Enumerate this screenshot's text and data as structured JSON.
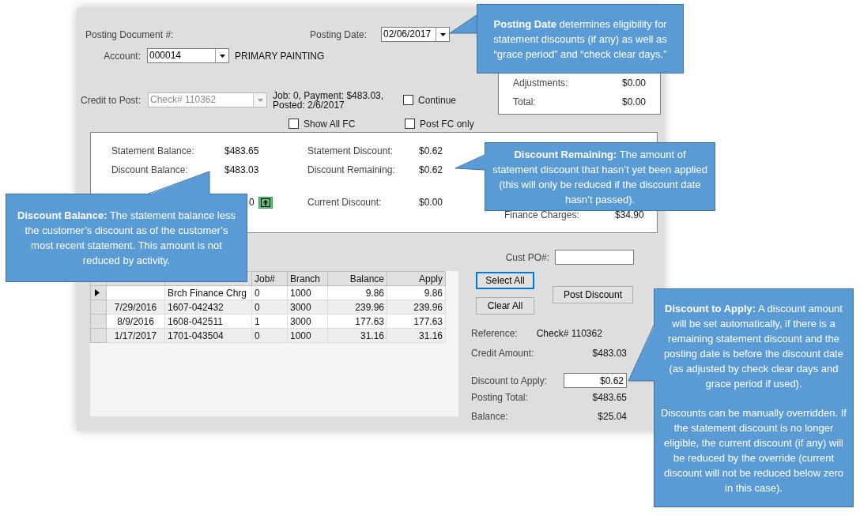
{
  "header": {
    "posting_document_label": "Posting Document #:",
    "posting_date_label": "Posting Date:",
    "posting_date": "02/06/2017",
    "account_label": "Account:",
    "account": "000014",
    "account_name": "PRIMARY PAINTING"
  },
  "summary": [
    {
      "label": "Adjustments:",
      "value": "$0.00"
    },
    {
      "label": "Total:",
      "value": "$0.00"
    }
  ],
  "credit": {
    "label": "Credit to Post:",
    "value": "Check# 110362",
    "disabled": true,
    "info": [
      "Job: 0, Payment: $483.03,",
      "Posted: 2/6/2017"
    ]
  },
  "options": [
    {
      "label": "Continue",
      "checked": false
    },
    {
      "label": "Show All FC",
      "checked": false
    },
    {
      "label": "Post FC only",
      "checked": false
    }
  ],
  "middle_panel": {
    "column_1": [
      {
        "label": "Statement Balance:",
        "value": "$483.65"
      },
      {
        "label": "Discount Balance:",
        "value": "$483.03"
      }
    ],
    "column_1_row_3": {
      "value": "0"
    },
    "column_2": [
      {
        "label": "Statement Discount:",
        "value": "$0.62"
      },
      {
        "label": "Discount Remaining:",
        "value": "$0.62"
      },
      {
        "label": "Current Discount:",
        "value": "$0.00"
      }
    ],
    "column_3": [
      {
        "label": "Finance Charges:",
        "value": "$34.90"
      }
    ]
  },
  "cust_po": {
    "label": "Cust PO#:"
  },
  "table": {
    "columns": [
      "Job#",
      "Branch",
      "Balance",
      "Apply"
    ],
    "rows": [
      {
        "document": "Brch Finance Chrg",
        "job": "0",
        "branch": "1000",
        "balance": "9.86",
        "apply": "9.86",
        "current": true
      },
      {
        "date": "7/29/2016",
        "document": "1607-042432",
        "job": "0",
        "branch": "3000",
        "balance": "239.96",
        "apply": "239.96",
        "current": false
      },
      {
        "date": "8/9/2016",
        "document": "1608-042511",
        "job": "1",
        "branch": "3000",
        "balance": "177.63",
        "apply": "177.63",
        "current": false
      },
      {
        "date": "1/17/2017",
        "document": "1701-043504",
        "job": "0",
        "branch": "1000",
        "balance": "31.16",
        "apply": "31.16",
        "current": false
      }
    ]
  },
  "buttons": [
    {
      "label": "Select All",
      "focused": true
    },
    {
      "label": "Clear All",
      "focused": false
    },
    {
      "label": "Post Discount",
      "focused": false
    }
  ],
  "totals": [
    {
      "label": "Reference:",
      "value": "Check# 110362",
      "kind": "text"
    },
    {
      "label": "Credit Amount:",
      "value": "$483.03",
      "kind": "amount"
    },
    {
      "label": "Discount to Apply:",
      "value": "$0.62",
      "kind": "input"
    },
    {
      "label": "Posting Total:",
      "value": "$483.65",
      "kind": "amount"
    },
    {
      "label": "Balance:",
      "value": "$25.04",
      "kind": "amount"
    }
  ],
  "callouts": [
    {
      "paragraphs": [
        "**Posting Date** determines eligibility for statement discounts (if any) as well as “grace period” and “check clear days.”"
      ]
    },
    {
      "paragraphs": [
        "**Discount Remaining:** The amount of statement discount that hasn’t yet been applied (this will only be reduced if the discount date hasn’t passed)."
      ]
    },
    {
      "paragraphs": [
        "**Discount Balance:** The statement balance less the customer’s discount as of the customer’s most recent statement. This amount is not reduced by activity."
      ]
    },
    {
      "paragraphs": [
        "**Discount to Apply:** A discount amount will be set automatically, if there is a remaining statement discount and the posting date is before the discount date (as adjusted by check clear days and grace period if used).",
        "Discounts can be manually overridden. If the statement discount is no longer eligible, the current discount (if any) will be reduced by the override (current discount will not be reduced below zero in this case)."
      ]
    }
  ]
}
